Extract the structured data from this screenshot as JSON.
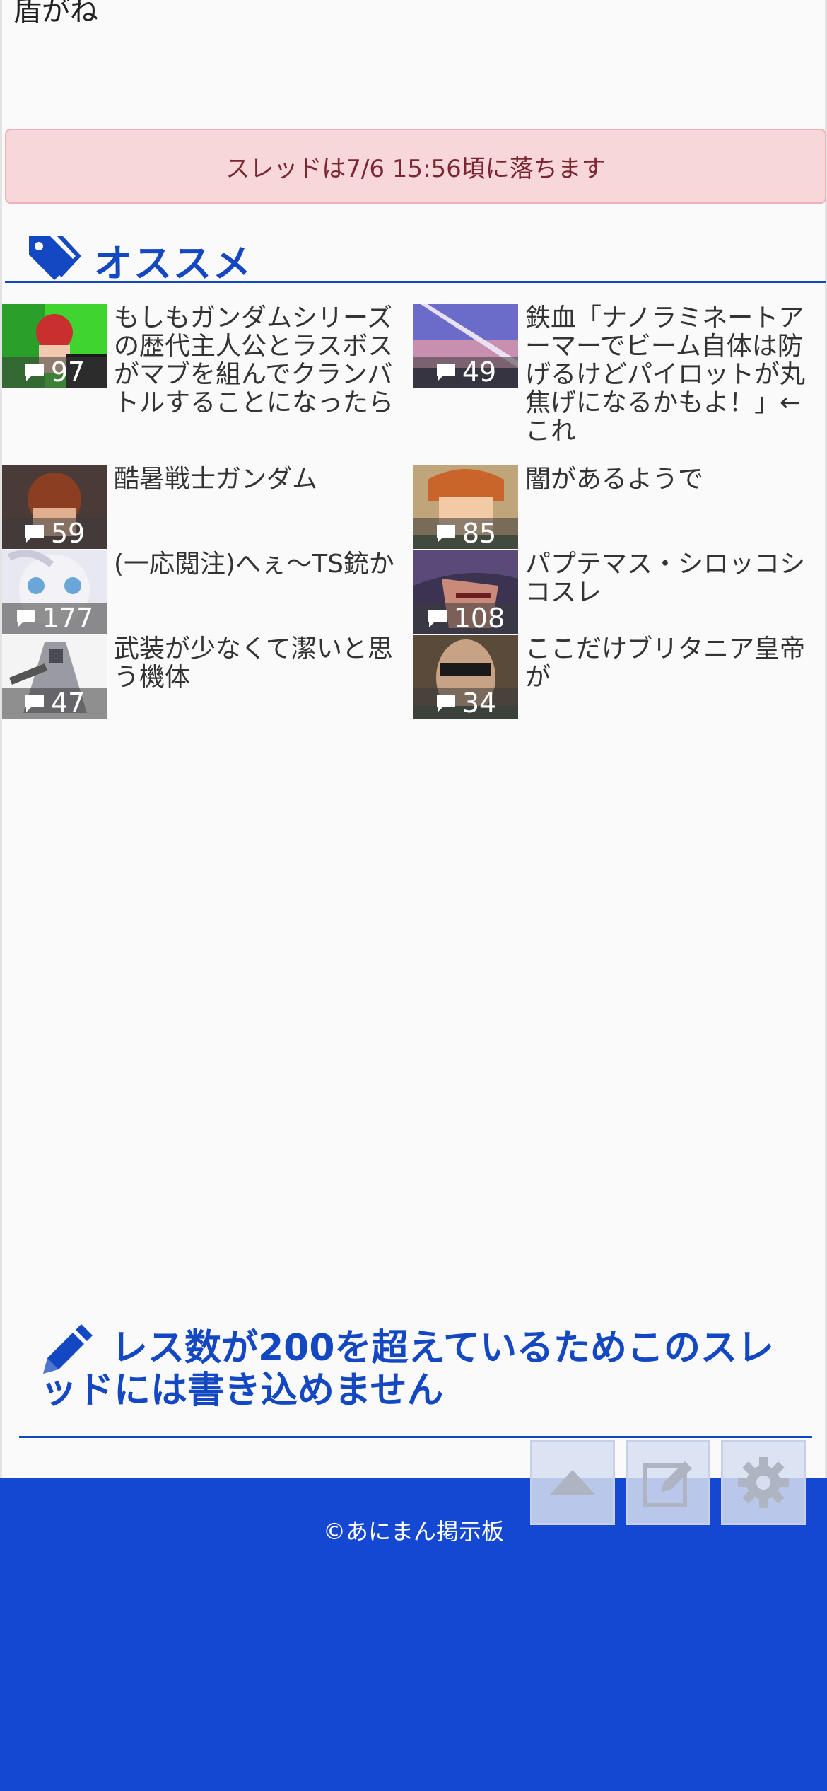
{
  "prev_post": {
    "text": "盾がね"
  },
  "notice": {
    "text": "スレッドは7/6 15:56頃に落ちます"
  },
  "recommend": {
    "title": "オススメ",
    "items": [
      {
        "title": "もしもガンダムシリーズの歴代主人公とラスボスがマブを組んでクランバトルすることになったら",
        "count": "97"
      },
      {
        "title": "鉄血「ナノラミネートアーマーでビーム自体は防げるけどパイロットが丸焦げになるかもよ！」←これ",
        "count": "49"
      },
      {
        "title": "酷暑戦士ガンダム",
        "count": "59"
      },
      {
        "title": "闇があるようで",
        "count": "85"
      },
      {
        "title": "(一応閲注)へぇ〜TS銃か",
        "count": "177"
      },
      {
        "title": "パプテマス・シロッコシコスレ",
        "count": "108"
      },
      {
        "title": "武装が少なくて潔いと思う機体",
        "count": "47"
      },
      {
        "title": "ここだけブリタニア皇帝が",
        "count": "34"
      }
    ]
  },
  "post_closed": {
    "text": "レス数が200を超えているためこのスレッドには書き込めません"
  },
  "footer": {
    "copyright": "©あにまん掲示板"
  },
  "fab": {
    "top": "arrow-up-icon",
    "write": "edit-icon",
    "settings": "gear-icon"
  },
  "colors": {
    "accent": "#1448c2",
    "footer_bg": "#1448d2",
    "notice_bg": "#f8d7da",
    "notice_text": "#7b2630"
  }
}
